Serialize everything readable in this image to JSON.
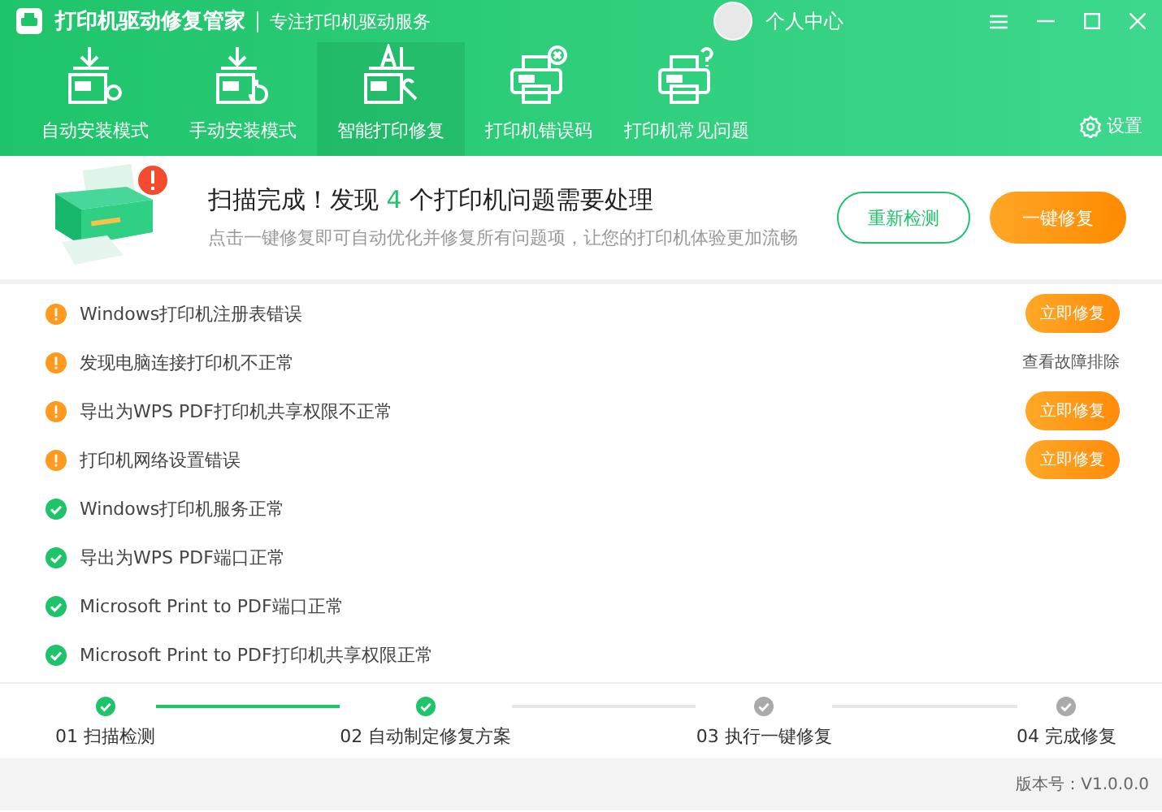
{
  "window": {
    "title": "打印机驱动修复管家",
    "subtitle": "专注打印机驱动服务",
    "user": "个人中心"
  },
  "toolbar": {
    "tabs": [
      {
        "label": "自动安装模式",
        "kind": "auto",
        "selected": false
      },
      {
        "label": "手动安装模式",
        "kind": "manual",
        "selected": false
      },
      {
        "label": "智能打印修复",
        "kind": "ai",
        "selected": true
      },
      {
        "label": "打印机错误码",
        "kind": "error",
        "selected": false
      },
      {
        "label": "打印机常见问题",
        "kind": "faq",
        "selected": false
      }
    ],
    "settings": "设置"
  },
  "summary": {
    "title_before": "扫描完成！发现",
    "count": "4",
    "title_after": "个打印机问题需要处理",
    "description": "点击一键修复即可自动优化并修复所有问题项，让您的打印机体验更加流畅",
    "rescan_button": "重新检测",
    "fix_all_button": "一键修复"
  },
  "issues": [
    {
      "kind": "error",
      "text": "Windows打印机注册表错误",
      "action": {
        "kind": "button",
        "label": "立即修复"
      }
    },
    {
      "kind": "error",
      "text": "发现电脑连接打印机不正常",
      "action": {
        "kind": "link",
        "label": "查看故障排除"
      }
    },
    {
      "kind": "error",
      "text": "导出为WPS PDF打印机共享权限不正常",
      "action": {
        "kind": "button",
        "label": "立即修复"
      }
    },
    {
      "kind": "error",
      "text": "打印机网络设置错误",
      "action": {
        "kind": "button",
        "label": "立即修复"
      }
    },
    {
      "kind": "ok",
      "text": "Windows打印机服务正常"
    },
    {
      "kind": "ok",
      "text": "导出为WPS PDF端口正常"
    },
    {
      "kind": "ok",
      "text": "Microsoft Print to PDF端口正常"
    },
    {
      "kind": "ok",
      "text": "Microsoft Print to PDF打印机共享权限正常"
    }
  ],
  "steps": [
    {
      "label": "01 扫描检测",
      "done": true
    },
    {
      "label": "02 自动制定修复方案",
      "done": true
    },
    {
      "label": "03 执行一键修复",
      "done": false
    },
    {
      "label": "04 完成修复",
      "done": false
    }
  ],
  "status_bar": {
    "version": "版本号：V1.0.0.0"
  }
}
